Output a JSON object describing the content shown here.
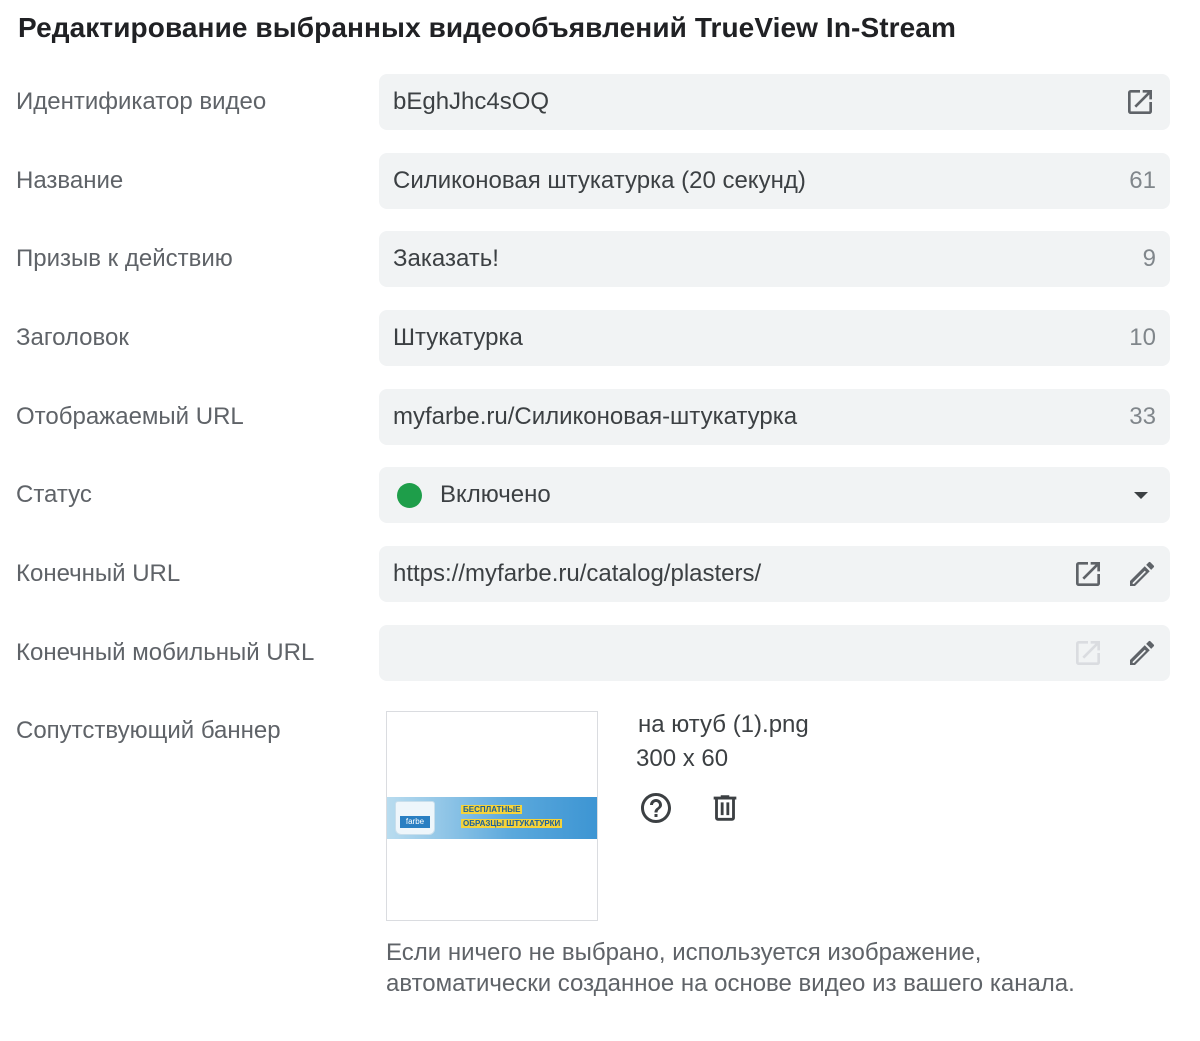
{
  "page_title": "Редактирование выбранных видеообъявлений TrueView In-Stream",
  "fields": {
    "video_id": {
      "label": "Идентификатор видео",
      "value": "bEghJhc4sOQ"
    },
    "name": {
      "label": "Название",
      "value": "Силиконовая штукатурка (20 секунд)",
      "count": "61"
    },
    "cta": {
      "label": "Призыв к действию",
      "value": "Заказать!",
      "count": "9"
    },
    "headline": {
      "label": "Заголовок",
      "value": "Штукатурка",
      "count": "10"
    },
    "display_url": {
      "label": "Отображаемый URL",
      "value": "myfarbe.ru/Силиконовая-штукатурка",
      "count": "33"
    },
    "status": {
      "label": "Статус",
      "value": "Включено",
      "color": "#1e9e4a"
    },
    "final_url": {
      "label": "Конечный URL",
      "value": "https://myfarbe.ru/catalog/plasters/"
    },
    "final_mobile_url": {
      "label": "Конечный мобильный URL",
      "value": ""
    },
    "companion_banner": {
      "label": "Сопутствующий баннер",
      "file_name": "на ютуб (1).png",
      "dimensions": "300 x 60",
      "banner_line1": "БЕСПЛАТНЫЕ",
      "banner_line2": "ОБРАЗЦЫ ШТУКАТУРКИ",
      "logo_text": "farbe",
      "hint": "Если ничего не выбрано, используется изображение, автоматически созданное на основе видео из вашего канала."
    }
  },
  "colors": {
    "field_bg": "#f1f3f4",
    "icon": "#5f6368",
    "icon_disabled": "#dadce0",
    "status_green": "#1e9e4a"
  }
}
